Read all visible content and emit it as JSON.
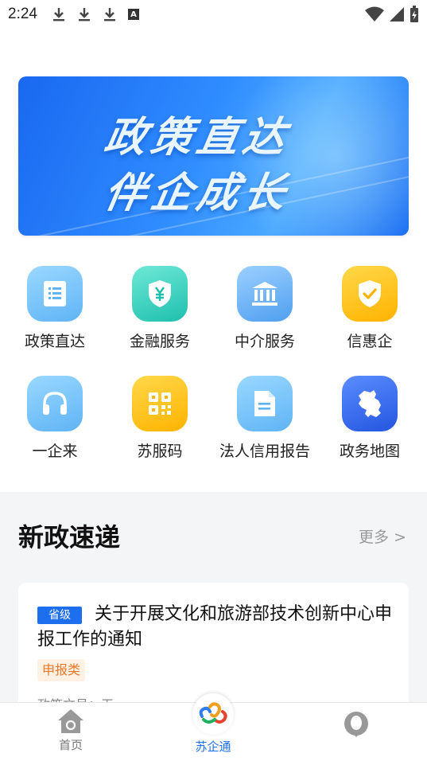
{
  "status_bar": {
    "time": "2:24",
    "a_indicator": "A"
  },
  "banner": {
    "line1": "政策直达",
    "line2": "伴企成长"
  },
  "grid": {
    "items": [
      {
        "label": "政策直达",
        "icon": "list-document-icon",
        "color": "#5fb4f5"
      },
      {
        "label": "金融服务",
        "icon": "yuan-shield-icon",
        "color": "#1fbfae"
      },
      {
        "label": "中介服务",
        "icon": "bank-building-icon",
        "color": "#4f9fef"
      },
      {
        "label": "信惠企",
        "icon": "check-shield-icon",
        "color": "#ffb300"
      },
      {
        "label": "一企来",
        "icon": "headset-icon",
        "color": "#5fb4f5"
      },
      {
        "label": "苏服码",
        "icon": "qr-code-icon",
        "color": "#ffb300"
      },
      {
        "label": "法人信用报告",
        "icon": "report-document-icon",
        "color": "#5fb4f5"
      },
      {
        "label": "政务地图",
        "icon": "map-icon",
        "color": "#2456e0"
      }
    ]
  },
  "news": {
    "title": "新政速递",
    "more": "更多 >",
    "card": {
      "level": "省级",
      "headline": "关于开展文化和旅游部技术创新中心申报工作的通知",
      "type": "申报类",
      "doc_no": "政策文号：无"
    }
  },
  "bottom_nav": {
    "home": "首页",
    "center": "苏企通",
    "active_color": "#1e6ff0"
  }
}
